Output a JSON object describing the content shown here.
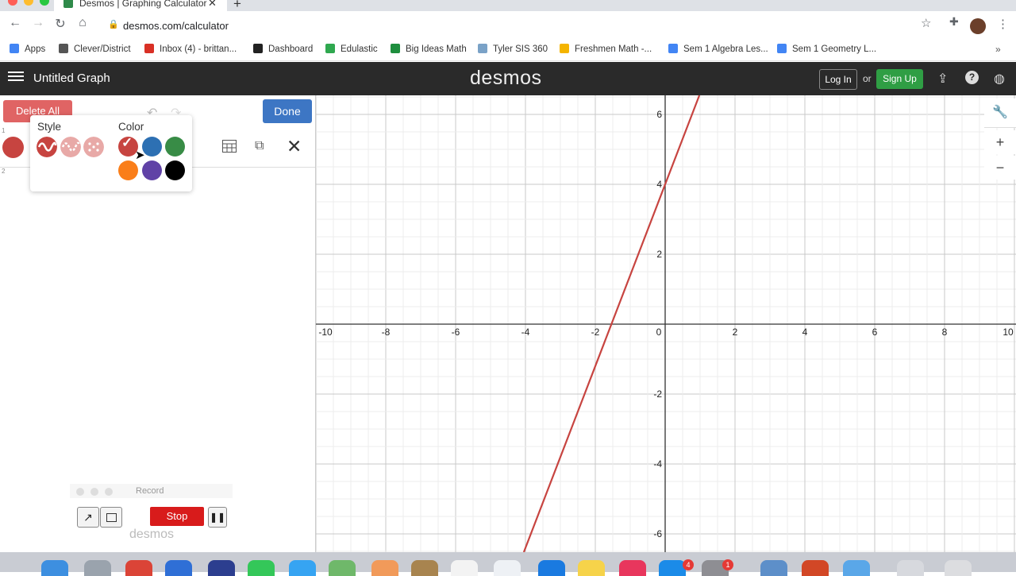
{
  "browser": {
    "tab_title": "Desmos | Graphing Calculator",
    "tab_close": "✕",
    "new_tab": "+",
    "url": "desmos.com/calculator",
    "bookmarks": [
      {
        "label": "Apps",
        "icon": "apps-grid-icon",
        "color": "#4285f4"
      },
      {
        "label": "Clever/District",
        "icon": "bank-icon",
        "color": "#555555"
      },
      {
        "label": "Inbox (4) - brittan...",
        "icon": "gmail-icon",
        "color": "#d93025"
      },
      {
        "label": "Dashboard",
        "icon": "dashboard-icon",
        "color": "#222222"
      },
      {
        "label": "Edulastic",
        "icon": "edulastic-icon",
        "color": "#2fa84f"
      },
      {
        "label": "Big Ideas Math",
        "icon": "big-ideas-icon",
        "color": "#1e8e3e"
      },
      {
        "label": "Tyler SIS 360",
        "icon": "tyler-icon",
        "color": "#7aa2c7"
      },
      {
        "label": "Freshmen Math -...",
        "icon": "drive-icon",
        "color": "#f4b400"
      },
      {
        "label": "Sem 1 Algebra Les...",
        "icon": "docs-icon",
        "color": "#4285f4"
      },
      {
        "label": "Sem 1 Geometry L...",
        "icon": "docs-icon",
        "color": "#4285f4"
      }
    ],
    "bookmarks_more": "»"
  },
  "header": {
    "title": "Untitled Graph",
    "logo": "desmos",
    "login": "Log In",
    "or": "or",
    "signup": "Sign Up"
  },
  "panel": {
    "delete_all": "Delete All",
    "done": "Done",
    "row_numbers": [
      "1",
      "2"
    ],
    "expression_color": "#c74440"
  },
  "popover": {
    "style_label": "Style",
    "color_label": "Color",
    "colors": [
      "#c74440",
      "#2d70b3",
      "#388c46",
      "#fa7e19",
      "#6042a6",
      "#000000"
    ],
    "selected_color": "#c74440"
  },
  "graph": {
    "x_ticks": [
      "-10",
      "-8",
      "-6",
      "-4",
      "-2",
      "0",
      "2",
      "4",
      "6",
      "8",
      "10"
    ],
    "y_ticks": [
      "6",
      "4",
      "2",
      "-2",
      "-4",
      "-6"
    ],
    "line_color": "#c74440",
    "line": {
      "slope": 2.6,
      "intercept": 4
    }
  },
  "recorder": {
    "title": "Record",
    "stop": "Stop",
    "pause": "❚❚",
    "watermark": "desmos"
  },
  "dock": {
    "badges": [
      "4",
      "1"
    ]
  }
}
